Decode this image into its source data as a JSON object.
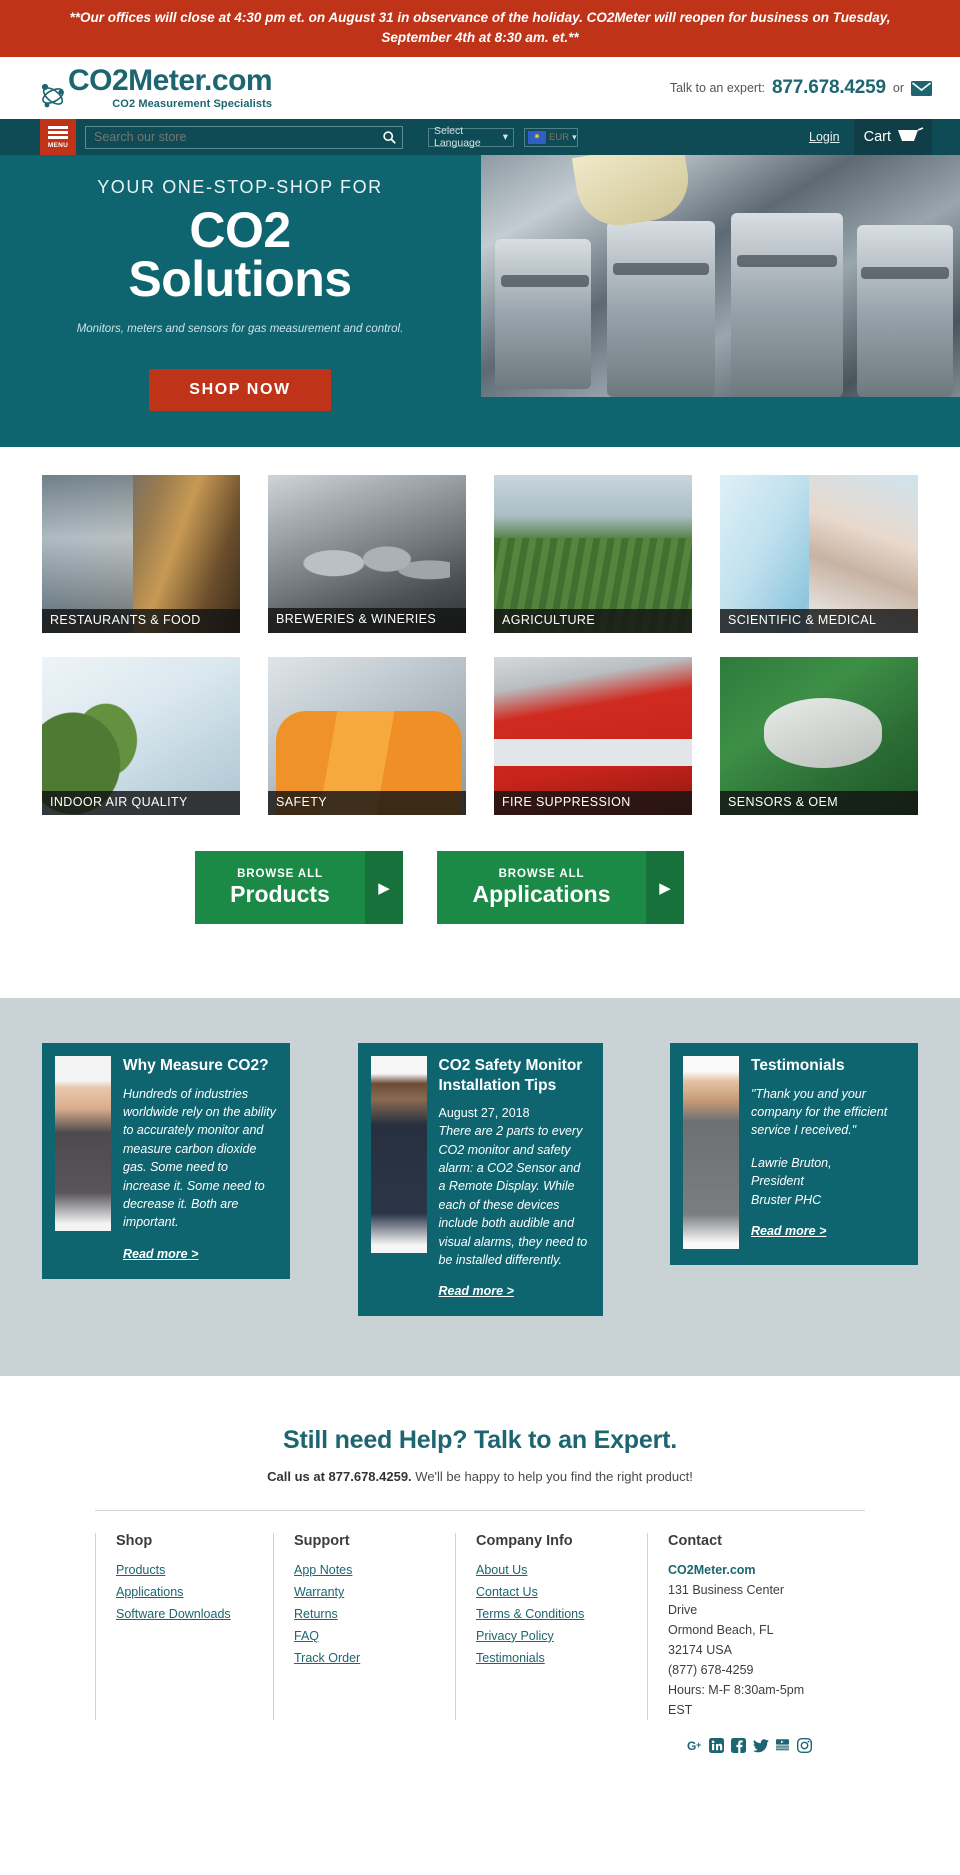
{
  "announcement": {
    "text": "**Our offices will close at 4:30 pm et. on August 31 in observance of the holiday. CO2Meter will reopen for business on Tuesday, September 4th at 8:30 am. et.**"
  },
  "header": {
    "logo_main": "CO2Meter.com",
    "logo_sub": "CO2 Measurement Specialists",
    "logo_icon": "atom-icon",
    "expert_label": "Talk to an expert:",
    "expert_phone": "877.678.4259",
    "or_label": "or",
    "email_icon": "envelope-icon"
  },
  "nav": {
    "menu_label": "MENU",
    "menu_icon": "hamburger-icon",
    "search_placeholder": "Search our store",
    "search_value": "",
    "search_icon": "search-icon",
    "language_label": "Select Language",
    "language_caret_icon": "chevron-down-icon",
    "currency_code": "EUR",
    "currency_flag_icon": "eu-flag-icon",
    "currency_caret_icon": "chevron-down-icon",
    "login_label": "Login",
    "cart_label": "Cart",
    "cart_icon": "shopping-cart-icon"
  },
  "hero": {
    "kicker": "YOUR ONE-STOP-SHOP FOR",
    "title_line1": "CO2",
    "title_line2": "Solutions",
    "subtitle": "Monitors, meters and sensors for gas measurement and control.",
    "cta_label": "SHOP NOW",
    "image_alt": "stainless-steel-tanks-photo"
  },
  "tiles": [
    {
      "label": "RESTAURANTS & FOOD",
      "photo": "ph-restaurant"
    },
    {
      "label": "BREWERIES & WINERIES",
      "photo": "ph-brewery"
    },
    {
      "label": "AGRICULTURE",
      "photo": "ph-agri"
    },
    {
      "label": "SCIENTIFIC & MEDICAL",
      "photo": "ph-sci"
    },
    {
      "label": "INDOOR AIR QUALITY",
      "photo": "ph-iaq"
    },
    {
      "label": "SAFETY",
      "photo": "ph-safety"
    },
    {
      "label": "FIRE SUPPRESSION",
      "photo": "ph-fire"
    },
    {
      "label": "SENSORS & OEM",
      "photo": "ph-oem"
    }
  ],
  "browse": {
    "products": {
      "small": "BROWSE ALL",
      "big": "Products",
      "arrow_icon": "arrow-right-icon"
    },
    "applications": {
      "small": "BROWSE ALL",
      "big": "Applications",
      "arrow_icon": "arrow-right-icon"
    }
  },
  "cards": [
    {
      "title": "Why Measure CO2?",
      "date": "",
      "body": "Hundreds of industries worldwide rely on the ability to accurately monitor and measure carbon dioxide gas. Some need to increase it. Some need to decrease it. Both are important.",
      "read_more": "Read more >",
      "photo_alt": "woman-thinking-photo"
    },
    {
      "title": "CO2 Safety Monitor Installation Tips",
      "date": "August 27, 2018",
      "body": "There are 2 parts to every CO2 monitor and safety alarm: a CO2 Sensor and a Remote Display. While each of these devices include both audible and visual alarms, they need to be installed differently.",
      "read_more": "Read more >",
      "photo_alt": "man-with-tablet-photo"
    },
    {
      "title": "Testimonials",
      "quote": "\"Thank you and your company for the efficient service I received.\"",
      "attribution_name": "Lawrie Bruton,",
      "attribution_title": "President",
      "attribution_company": "Bruster PHC",
      "read_more": "Read more >",
      "photo_alt": "man-in-suit-photo"
    }
  ],
  "help": {
    "title": "Still need Help? Talk to an Expert.",
    "call_bold": "Call us at 877.678.4259.",
    "call_rest": " We'll be happy to help you find the right product!"
  },
  "footer": {
    "columns": [
      {
        "heading": "Shop",
        "links": [
          "Products",
          "Applications",
          "Software Downloads"
        ]
      },
      {
        "heading": "Support",
        "links": [
          "App Notes",
          "Warranty",
          "Returns",
          "FAQ",
          "Track Order"
        ]
      },
      {
        "heading": "Company Info",
        "links": [
          "About Us",
          "Contact Us",
          "Terms & Conditions",
          "Privacy Policy",
          "Testimonials"
        ]
      }
    ],
    "contact": {
      "heading": "Contact",
      "company": "CO2Meter.com",
      "line1": "131 Business Center",
      "line2": "Drive",
      "line3": "Ormond Beach, FL",
      "line4": "32174 USA",
      "line5": "(877) 678-4259",
      "line6": "Hours: M-F 8:30am-5pm",
      "line7": "EST"
    },
    "social": [
      {
        "name": "google-plus-icon",
        "glyph": "G+"
      },
      {
        "name": "linkedin-icon",
        "glyph": "in"
      },
      {
        "name": "facebook-icon",
        "glyph": "f"
      },
      {
        "name": "twitter-icon",
        "glyph": "t"
      },
      {
        "name": "youtube-icon",
        "glyph": "yt"
      },
      {
        "name": "instagram-icon",
        "glyph": "ig"
      }
    ]
  },
  "colors": {
    "accent_red": "#bf3318",
    "brand_teal": "#0e6570",
    "nav_teal": "#0e4b55",
    "green": "#1b8a46",
    "card_bg_gray": "#c9d3d6"
  }
}
